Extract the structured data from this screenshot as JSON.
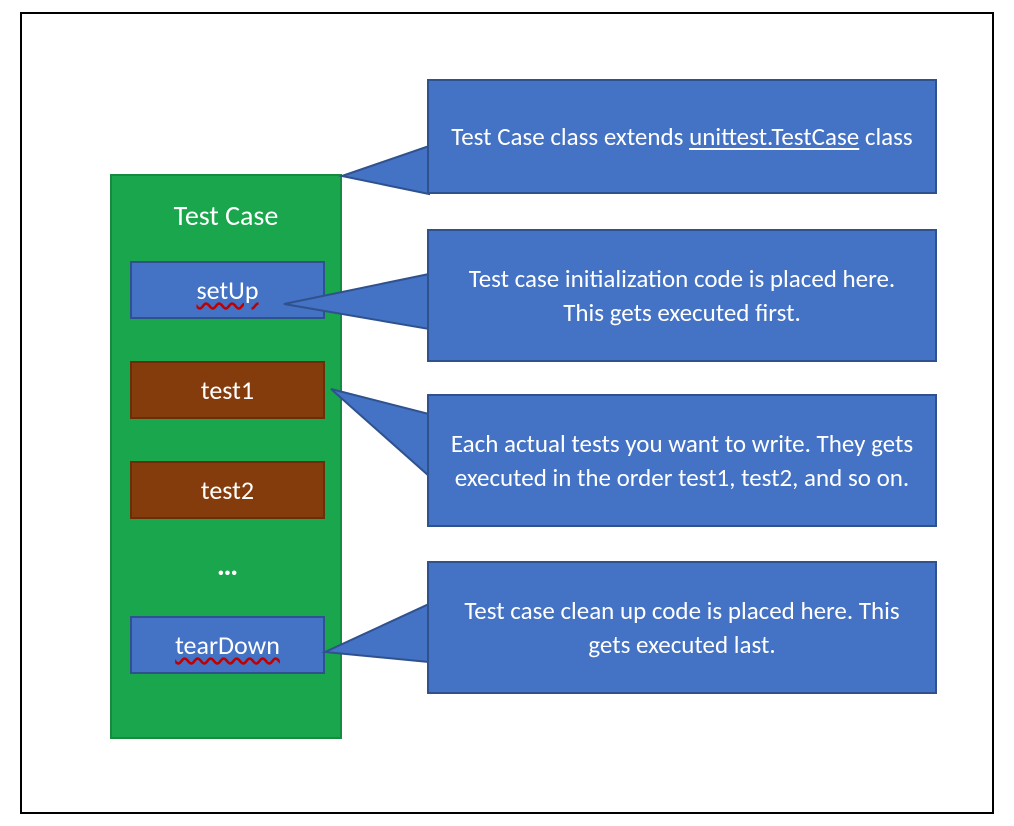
{
  "colors": {
    "green": "#1AA64C",
    "blue": "#4472C4",
    "brown": "#843C0C",
    "outline_blue": "#2F528F"
  },
  "testcase": {
    "title": "Test Case",
    "setup_label": "setUp",
    "test1_label": "test1",
    "test2_label": "test2",
    "ellipsis": "…",
    "teardown_label": "tearDown"
  },
  "callouts": {
    "class": {
      "text_before": "Test Case class extends ",
      "underlined": "unittest.TestCase",
      "text_after": " class"
    },
    "setup": "Test case initialization code is placed here. This gets executed first.",
    "tests": "Each actual tests you want to write. They gets executed in the order test1, test2, and so on.",
    "teardown": "Test case clean up code is placed here. This gets executed last."
  }
}
